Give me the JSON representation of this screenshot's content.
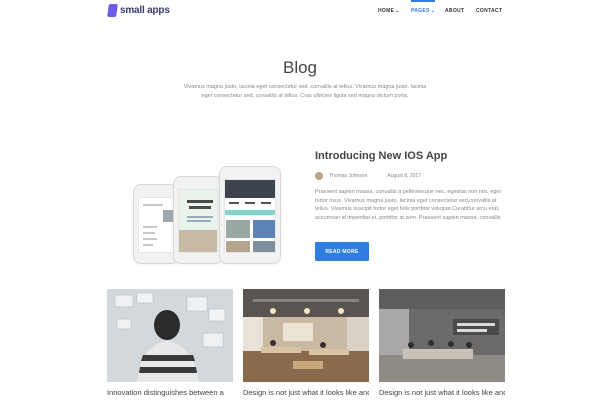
{
  "brand": {
    "name": "small apps",
    "accent": "#2f7fe0",
    "logo_color": "#6c5ce7"
  },
  "nav": {
    "items": [
      {
        "label": "HOME",
        "has_dropdown": true,
        "active": false
      },
      {
        "label": "PAGES",
        "has_dropdown": true,
        "active": true
      },
      {
        "label": "ABOUT",
        "has_dropdown": false,
        "active": false
      },
      {
        "label": "CONTACT",
        "has_dropdown": false,
        "active": false
      }
    ]
  },
  "hero": {
    "title": "Blog",
    "intro": "Vivamus magna justo, lacinia eget consectetur sed, convallis at tellus. Vivamus magna justo, lacinia eget consectetur sed, convallis at tellus. Cras ultricies ligula sed magna dictum porta."
  },
  "featured": {
    "title": "Introducing New IOS App",
    "author": "Thomas Johnson",
    "date": "August 8, 2017",
    "excerpt": "Praesent sapien massa, convallis a pellentesque nec, egestas non nisi, eget tortor risus. Vivamus magna justo, lacinia eget consectetur sed,convallis at tellus. Vivamus suscipit tortor eget felis porttitor volutpat.Curabitur arcu erat, accumsan id imperdiet et, porttitor at sem. Praesent sapien massa, convallis",
    "button_label": "READ MORE"
  },
  "cards": [
    {
      "title": "Innovation distinguishes between a"
    },
    {
      "title": "Design is not just what it looks like and"
    },
    {
      "title": "Design is not just what it looks like and"
    }
  ]
}
